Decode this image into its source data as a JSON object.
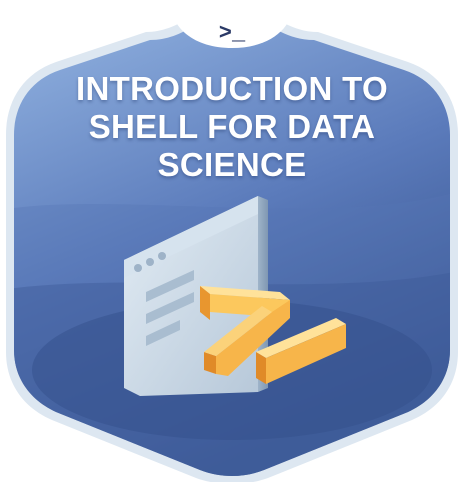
{
  "badge": {
    "prompt_glyph": ">_",
    "title": "INTRODUCTION TO SHELL FOR DATA SCIENCE",
    "illustration": "terminal-window-with-prompt-icon",
    "colors": {
      "border": "#d6e2ee",
      "background_top": "#8fb1df",
      "background_bottom": "#3c5994",
      "window": "#c9d8e6",
      "prompt_orange": "#f5a742",
      "prompt_yellow": "#fcd77d"
    }
  }
}
